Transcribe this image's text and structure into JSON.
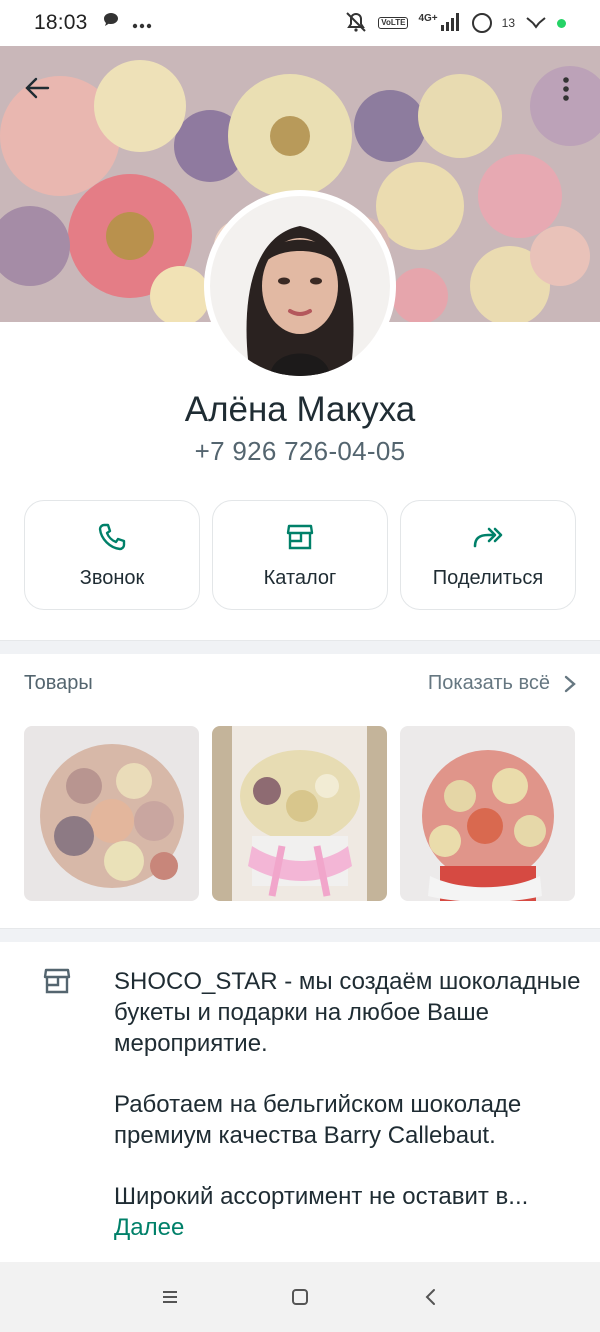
{
  "status_bar": {
    "time": "18:03",
    "network": "4G+",
    "lte": "VoLTE",
    "battery_level": "13",
    "icons": [
      "chat-bubble-icon",
      "more-dots-icon",
      "muted-bell-icon",
      "signal-icon",
      "battery-icon",
      "vpn-icon"
    ],
    "dot_color": "#25d366"
  },
  "header": {
    "back_icon": "arrow-left-icon",
    "menu_icon": "more-vertical-icon"
  },
  "profile": {
    "name": "Алёна Макуха",
    "phone": "+7 926 726-04-05"
  },
  "actions": [
    {
      "label": "Звонок",
      "icon": "phone-icon"
    },
    {
      "label": "Каталог",
      "icon": "storefront-icon"
    },
    {
      "label": "Поделиться",
      "icon": "share-arrow-icon"
    }
  ],
  "products": {
    "title": "Товары",
    "show_all": "Показать всё",
    "items": [
      "product-bouquet-1",
      "product-bouquet-2",
      "product-bouquet-3"
    ]
  },
  "description": {
    "icon": "storefront-icon",
    "paragraphs": [
      "SHOCO_STAR - мы создаём шоколадные букеты и подарки на любое Ваше мероприятие.",
      "Работаем на бельгийском шоколаде премиум качества Barry Callebaut.",
      "Широкий ассортимент не оставит в..."
    ],
    "more": "Далее"
  },
  "nav": {
    "icons": [
      "recents-icon",
      "home-icon",
      "back-icon"
    ]
  },
  "colors": {
    "accent": "#008069",
    "text_primary": "#1f2c33",
    "text_secondary": "#54656f",
    "divider": "#f0f2f5"
  }
}
